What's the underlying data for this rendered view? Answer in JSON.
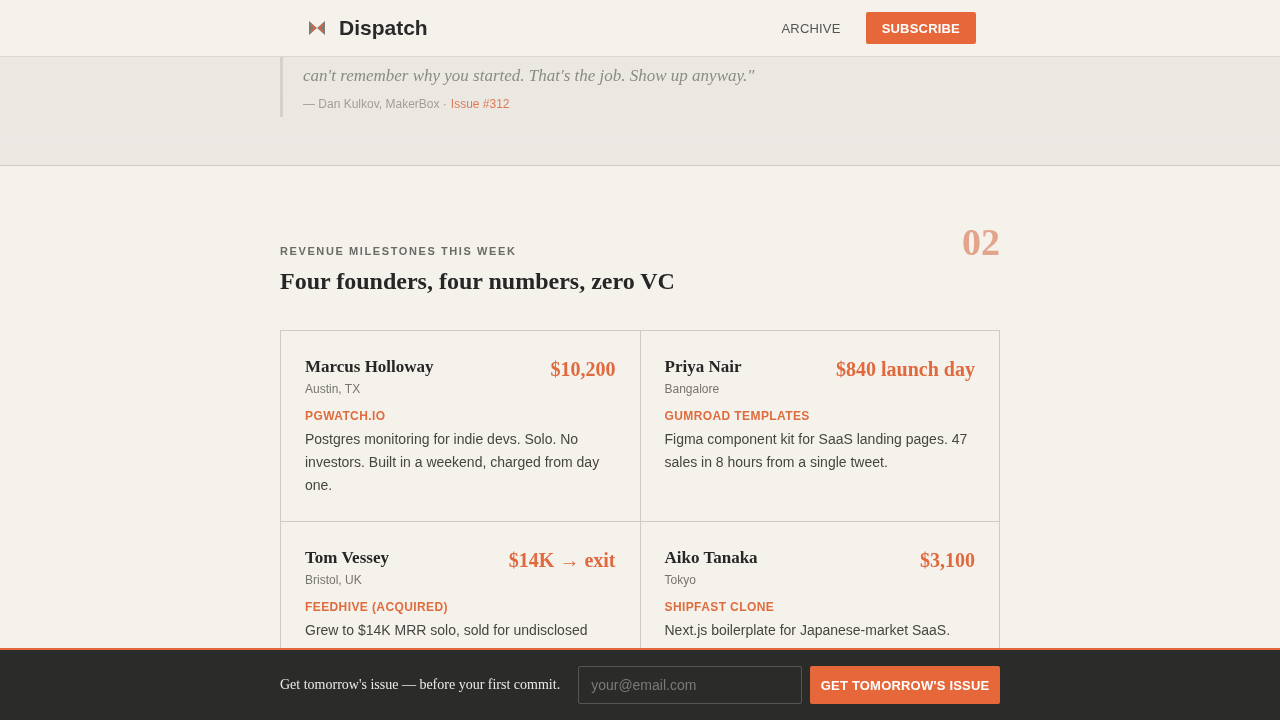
{
  "header": {
    "brand": "Dispatch",
    "nav": [
      {
        "label": "ARCHIVE",
        "kind": "link"
      },
      {
        "label": "SUBSCRIBE",
        "kind": "button"
      }
    ]
  },
  "quote": {
    "text": "can't remember why you started. That's the job. Show up anyway.\"",
    "attribution": "— Dan Kulkov, MakerBox ·",
    "issue_link": "Issue #312"
  },
  "section": {
    "number": "02",
    "eyebrow": "REVENUE MILESTONES THIS WEEK",
    "title": "Four founders, four numbers, zero VC",
    "cards": [
      {
        "name": "Marcus Holloway",
        "location": "Austin, TX",
        "amount": "$10,200",
        "product": "PGWATCH.IO",
        "description": "Postgres monitoring for indie devs. Solo. No investors. Built in a weekend, charged from day one."
      },
      {
        "name": "Priya Nair",
        "location": "Bangalore",
        "amount": "$840 launch day",
        "product": "GUMROAD TEMPLATES",
        "description": "Figma component kit for SaaS landing pages. 47 sales in 8 hours from a single tweet."
      },
      {
        "name": "Tom Vessey",
        "location": "Bristol, UK",
        "amount": "$14K → exit",
        "product": "FEEDHIVE (ACQUIRED)",
        "description": "Grew to $14K MRR solo, sold for undisclosed"
      },
      {
        "name": "Aiko Tanaka",
        "location": "Tokyo",
        "amount": "$3,100",
        "product": "SHIPFAST CLONE",
        "description": "Next.js boilerplate for Japanese-market SaaS."
      }
    ]
  },
  "signup_bar": {
    "text": "Get tomorrow's issue — before your first commit.",
    "email_placeholder": "your@email.com",
    "button": "GET TOMORROW'S ISSUE"
  }
}
